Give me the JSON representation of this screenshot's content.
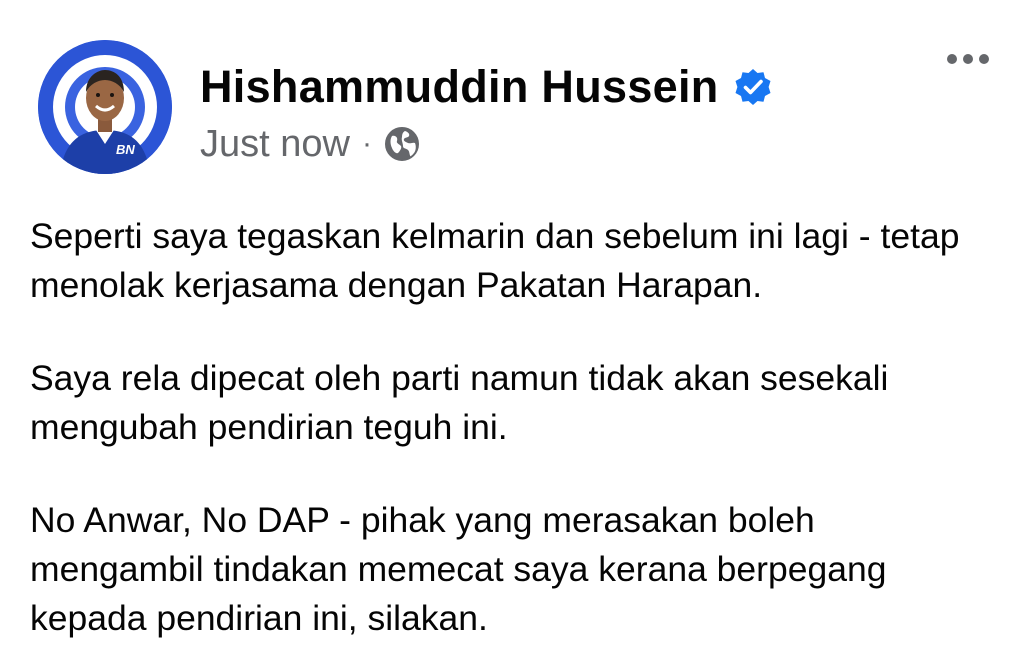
{
  "post": {
    "author": {
      "name": "Hishammuddin Hussein",
      "avatar_badge_text": "BN",
      "verified_icon": "verified-badge-icon"
    },
    "meta": {
      "timestamp": "Just now",
      "separator": "·",
      "privacy_icon": "globe-icon"
    },
    "more_icon": "more-options-icon",
    "paragraphs": [
      "Seperti saya tegaskan kelmarin dan sebelum ini lagi - tetap\nmenolak kerjasama dengan Pakatan Harapan.",
      "Saya rela dipecat oleh parti namun tidak akan sesekali\nmengubah pendirian teguh ini.",
      "No Anwar, No DAP - pihak yang merasakan boleh\nmengambil tindakan memecat saya kerana berpegang\nkepada pendirian ini, silakan."
    ]
  },
  "colors": {
    "text_primary": "#050505",
    "text_secondary": "#65676b",
    "verified_blue": "#1877f2",
    "avatar_ring": "#2c55d6"
  }
}
